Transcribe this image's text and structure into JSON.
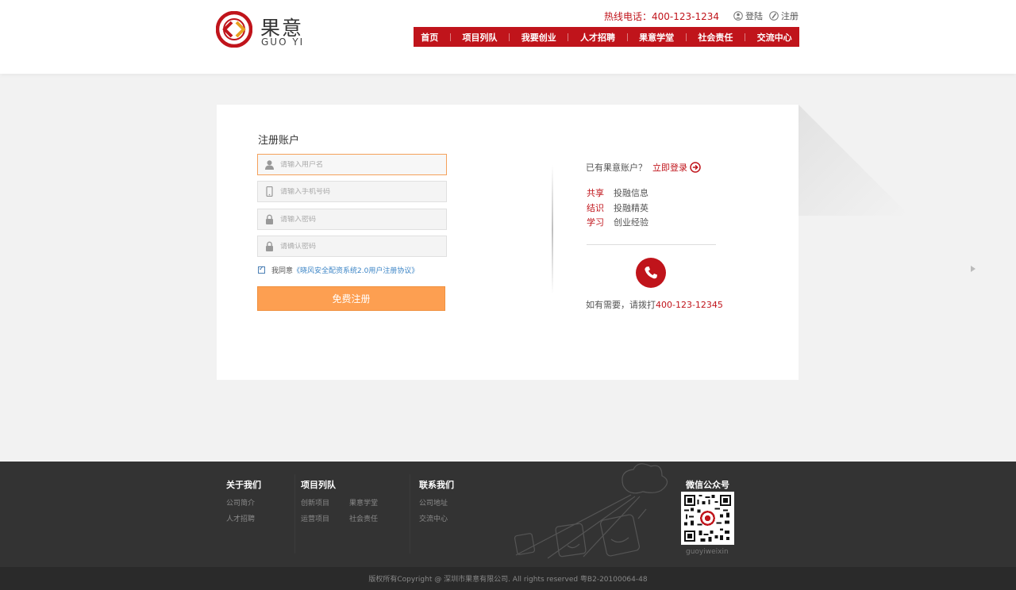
{
  "brand": {
    "name_cn": "果意",
    "name_en": "GUO YI",
    "colors": {
      "primary": "#c0141b",
      "accent": "#fd9f51",
      "footer": "#333333"
    }
  },
  "topbar": {
    "hotline": "热线电话：400-123-1234",
    "login_label": "登陆",
    "register_label": "注册"
  },
  "nav": [
    "首页",
    "项目列队",
    "我要创业",
    "人才招聘",
    "果意学堂",
    "社会责任",
    "交流中心"
  ],
  "form": {
    "title": "注册账户",
    "username_placeholder": "请输入用户名",
    "phone_placeholder": "请输入手机号码",
    "password_placeholder": "请输入密码",
    "confirm_placeholder": "请确认密码",
    "agree_prefix": "我同意",
    "agree_link": "《晓风安全配资系统2.0用户注册协议》",
    "submit_label": "免费注册",
    "agreed": true
  },
  "side": {
    "have_account": "已有果意账户？",
    "login_now": "立即登录",
    "features": [
      {
        "key": "共享",
        "value": "投融信息"
      },
      {
        "key": "结识",
        "value": "投融精英"
      },
      {
        "key": "学习",
        "value": "创业经验"
      }
    ],
    "call_prefix": "如有需要，请拨打",
    "call_number": "400-123-12345"
  },
  "footer": {
    "about": {
      "title": "关于我们",
      "links": [
        "公司简介",
        "人才招聘"
      ]
    },
    "projects": {
      "title": "项目列队",
      "links": [
        "创新项目",
        "果意学堂",
        "运营项目",
        "社会责任"
      ]
    },
    "contact": {
      "title": "联系我们",
      "links": [
        "公司地址",
        "交流中心"
      ]
    },
    "wechat": {
      "title": "微信公众号",
      "account": "guoyiweixin"
    },
    "copyright": "版权所有Copyright @ 深圳市果意有限公司. All rights reserved 粤B2-20100064-48"
  }
}
